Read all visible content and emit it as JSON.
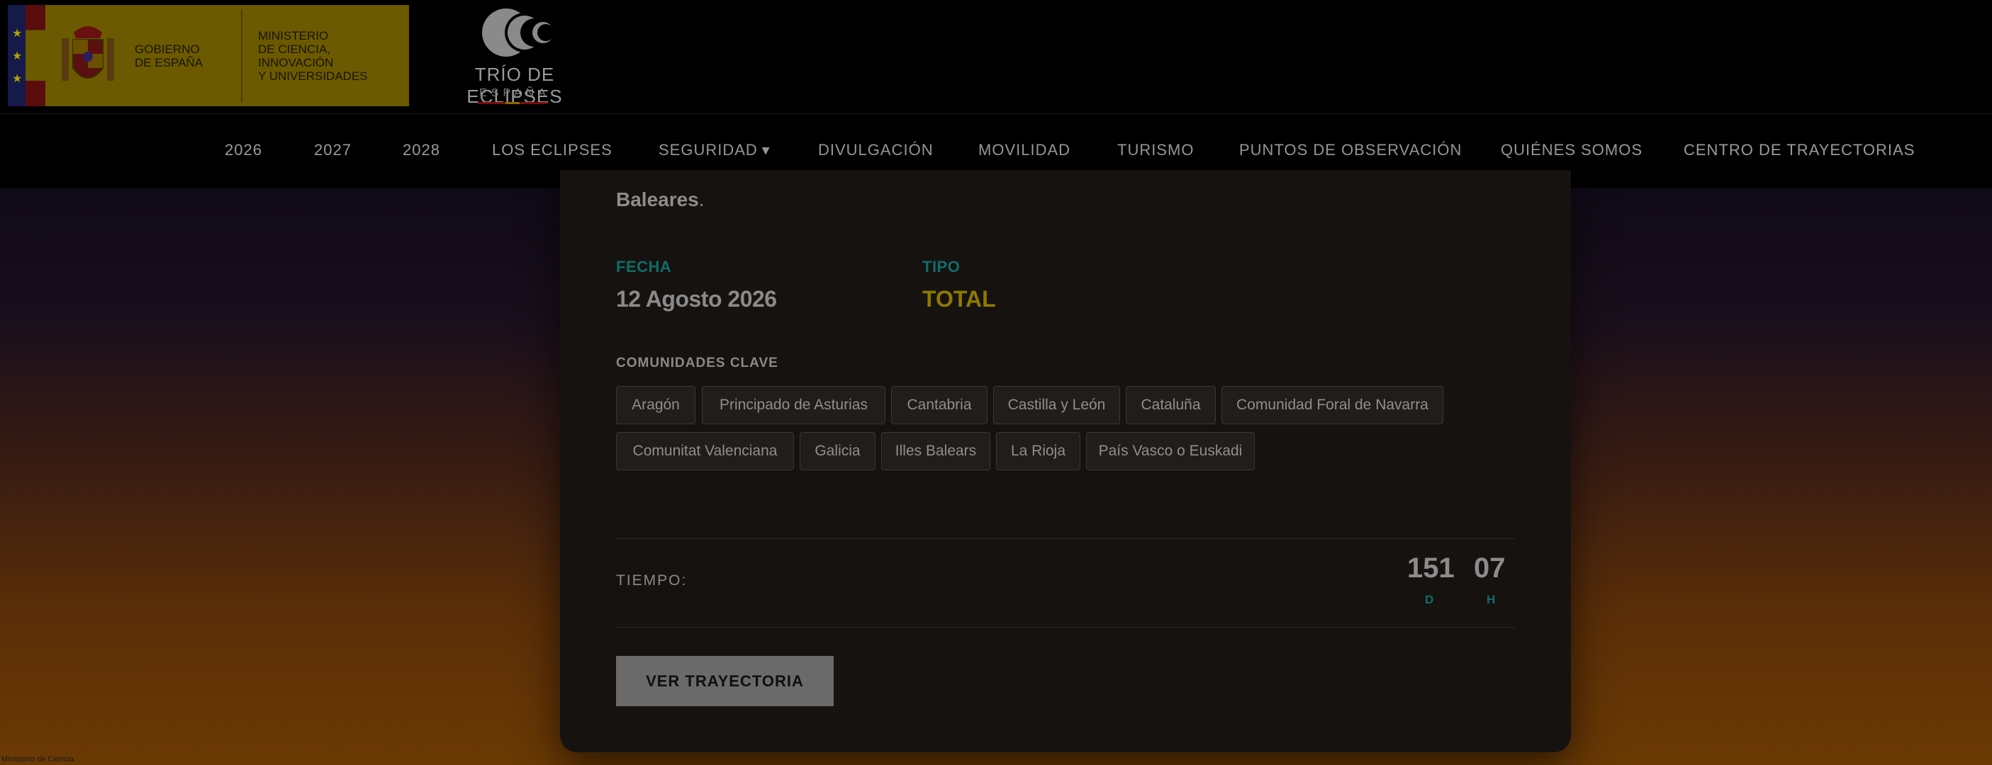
{
  "header": {
    "gov_logo": {
      "gobierno": [
        "GOBIERNO",
        "DE ESPAÑA"
      ],
      "ministerio": [
        "MINISTERIO",
        "DE CIENCIA, INNOVACIÓN",
        "Y UNIVERSIDADES"
      ]
    },
    "trio_logo": {
      "name": "TRÍO DE ECLIPSES",
      "country": "ESPAÑA"
    }
  },
  "nav": {
    "items": [
      {
        "label": "2026"
      },
      {
        "label": "2027"
      },
      {
        "label": "2028"
      },
      {
        "label": "LOS ECLIPSES"
      },
      {
        "label": "SEGURIDAD",
        "has_dropdown": true
      },
      {
        "label": "DIVULGACIÓN"
      },
      {
        "label": "MOVILIDAD"
      },
      {
        "label": "TURISMO"
      },
      {
        "label": "PUNTOS DE OBSERVACIÓN"
      },
      {
        "label": "QUIÉNES SOMOS"
      },
      {
        "label": "CENTRO DE TRAYECTORIAS"
      }
    ]
  },
  "card": {
    "intro_tail": "Baleares",
    "intro_dot": ".",
    "fecha_label": "FECHA",
    "fecha_value": "12 Agosto 2026",
    "tipo_label": "TIPO",
    "tipo_value": "TOTAL",
    "comunidades_label": "COMUNIDADES CLAVE",
    "comunidades": [
      "Aragón",
      "Principado de Asturias",
      "Cantabria",
      "Castilla y León",
      "Cataluña",
      "Comunidad Foral de Navarra",
      "Comunitat Valenciana",
      "Galicia",
      "Illes Balears",
      "La Rioja",
      "País Vasco o Euskadi"
    ],
    "tiempo_label": "TIEMPO:",
    "countdown": {
      "days": "151",
      "days_unit": "D",
      "hours": "07",
      "hours_unit": "H"
    },
    "cta_label": "VER TRAYECTORIA"
  },
  "footer": {
    "text": "Ministerio de Ciencia"
  },
  "colors": {
    "accent_teal": "#0f6d6b",
    "accent_gold": "#8d7a00"
  }
}
